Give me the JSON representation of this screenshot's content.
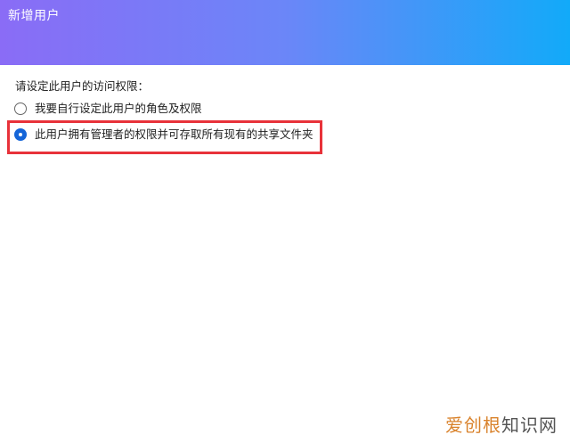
{
  "header": {
    "title": "新增用户"
  },
  "main": {
    "prompt": "请设定此用户的访问权限：",
    "options": [
      {
        "label": "我要自行设定此用户的角色及权限",
        "selected": false
      },
      {
        "label": "此用户拥有管理者的权限并可存取所有现有的共享文件夹",
        "selected": true
      }
    ]
  },
  "highlight": {
    "color": "#e8323a"
  },
  "colors": {
    "header_gradient_start": "#8a6cf6",
    "header_gradient_end": "#12aaf9",
    "radio_selected": "#1565d8"
  },
  "watermark": {
    "accent_text": "爱创根",
    "text": "知识网"
  }
}
